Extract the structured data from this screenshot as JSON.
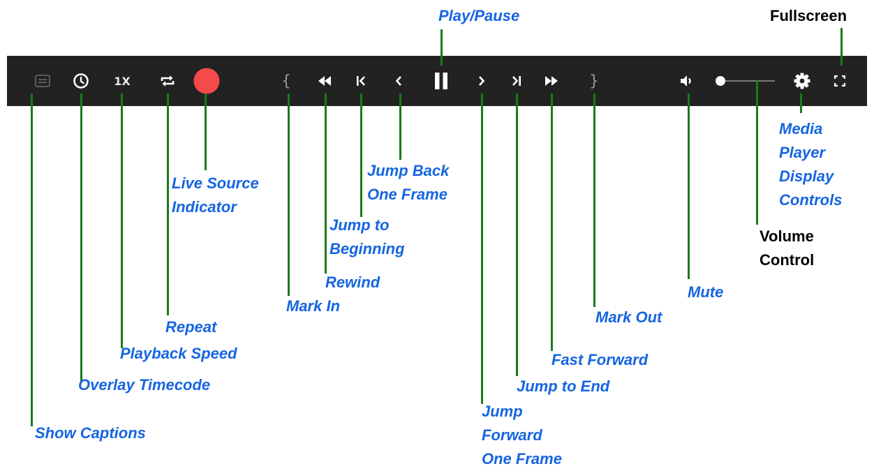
{
  "toolbar": {
    "speed_label": "1X",
    "mark_in_glyph": "{",
    "mark_out_glyph": "}",
    "icons": [
      "captions-icon",
      "clock-icon",
      "repeat-icon",
      "record-dot-icon",
      "rewind-icon",
      "skip-to-start-icon",
      "step-back-icon",
      "pause-icon",
      "step-forward-icon",
      "skip-to-end-icon",
      "fast-forward-icon",
      "volume-icon",
      "gear-icon",
      "fullscreen-icon"
    ],
    "record_color": "#f44a4a",
    "background_color": "#222222",
    "volume_level": 0
  },
  "labels": {
    "show_captions": "Show Captions",
    "overlay_timecode": "Overlay Timecode",
    "playback_speed": "Playback Speed",
    "repeat": "Repeat",
    "live_source_line1": "Live Source",
    "live_source_line2": "Indicator",
    "mark_in": "Mark In",
    "rewind": "Rewind",
    "jump_beginning_line1": "Jump to",
    "jump_beginning_line2": "Beginning",
    "jump_back_line1": "Jump Back",
    "jump_back_line2": "One Frame",
    "play_pause": "Play/Pause",
    "jump_forward_line1": "Jump",
    "jump_forward_line2": "Forward",
    "jump_forward_line3": "One Frame",
    "jump_end": "Jump to End",
    "fast_forward": "Fast Forward",
    "mark_out": "Mark Out",
    "mute": "Mute",
    "volume_line1": "Volume",
    "volume_line2": "Control",
    "media_line1": "Media",
    "media_line2": "Player",
    "media_line3": "Display",
    "media_line4": "Controls",
    "fullscreen": "Fullscreen"
  },
  "colors": {
    "label_blue": "#1565e0",
    "leader_green": "#1a7a1a",
    "label_black": "#000000"
  }
}
